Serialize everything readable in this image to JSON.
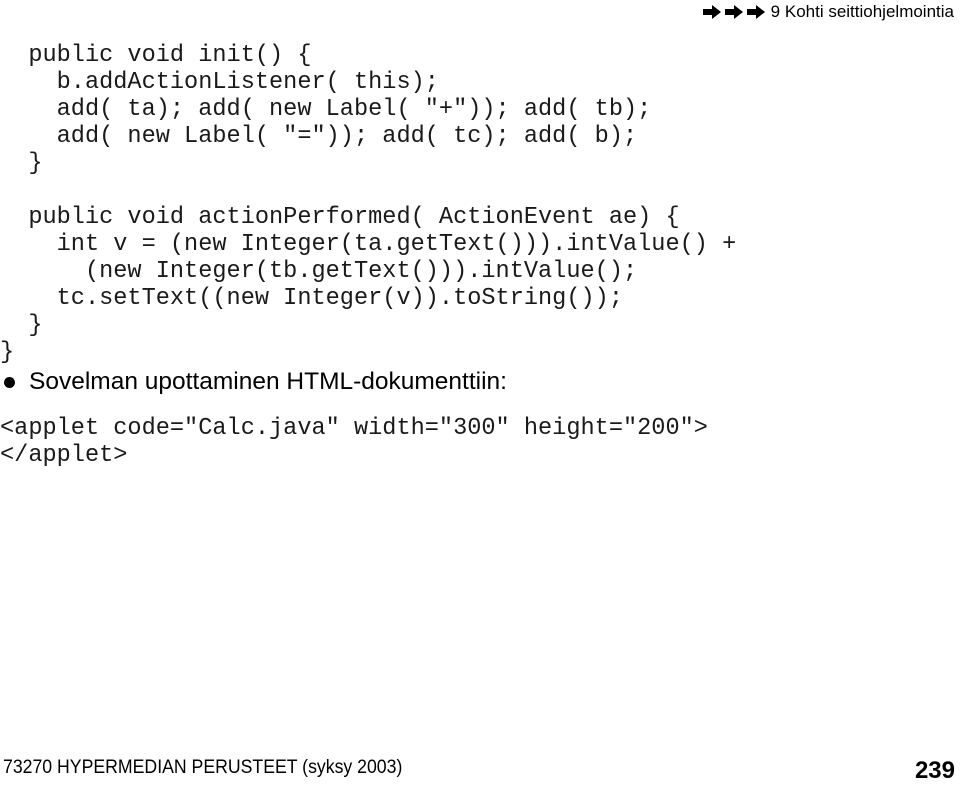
{
  "header": {
    "icons": [
      "arrow-right-icon",
      "arrow-right-icon",
      "arrow-right-icon"
    ],
    "chapter_title": "9 Kohti seittiohjelmointia"
  },
  "code_block_1": {
    "lines": [
      "  public void init() {",
      "    b.addActionListener( this);",
      "    add( ta); add( new Label( \"+\")); add( tb);",
      "    add( new Label( \"=\")); add( tc); add( b);",
      "  }",
      "",
      "  public void actionPerformed( ActionEvent ae) {",
      "    int v = (new Integer(ta.getText())).intValue() +",
      "      (new Integer(tb.getText())).intValue();",
      "    tc.setText((new Integer(v)).toString());",
      "  }",
      "}"
    ]
  },
  "bullet": {
    "text": "Sovelman upottaminen HTML-dokumenttiin:"
  },
  "code_block_2": {
    "lines": [
      "<applet code=\"Calc.java\" width=\"300\" height=\"200\">",
      "</applet>"
    ]
  },
  "footer": {
    "course": "73270 HYPERMEDIAN PERUSTEET (syksy 2003)",
    "page_number": "239"
  }
}
